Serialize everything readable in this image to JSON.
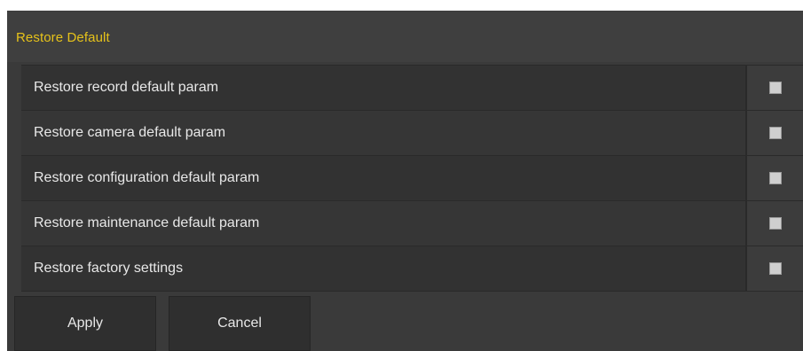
{
  "panel": {
    "title": "Restore Default",
    "title_color": "#e6c21a"
  },
  "options": [
    {
      "label": "Restore record default param",
      "checked": false
    },
    {
      "label": "Restore camera default param",
      "checked": false
    },
    {
      "label": "Restore configuration default param",
      "checked": false
    },
    {
      "label": "Restore maintenance default param",
      "checked": false
    },
    {
      "label": "Restore factory settings",
      "checked": false
    }
  ],
  "buttons": {
    "apply_label": "Apply",
    "cancel_label": "Cancel"
  }
}
